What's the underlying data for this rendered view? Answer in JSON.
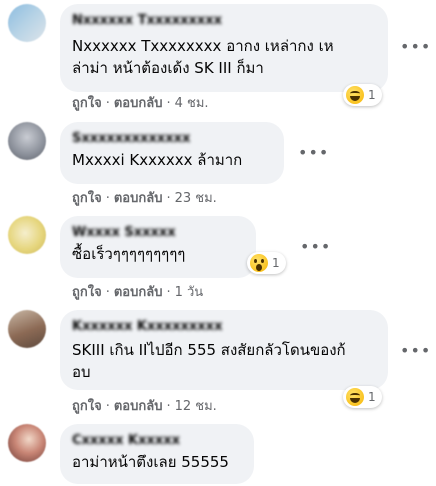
{
  "comments": [
    {
      "name": "Nxxxxxx Txxxxxxxxx",
      "text_lines": [
        "Nxxxxxx Txxxxxxxx อากง เหล่ากง เห",
        "ล่าม่า หน้าต้องเด้ง SK III ก็มา"
      ],
      "like": "ถูกใจ",
      "reply": "ตอบกลับ",
      "time": "4 ชม.",
      "reaction": {
        "icon": "laugh-emoji-icon",
        "count": "1"
      },
      "avatar_colors": [
        "#7fb2d8",
        "#a9c9de",
        "#cfd9e0"
      ]
    },
    {
      "name": "Sxxxxxxxxxxxxx",
      "text_lines": [
        "Mxxxxi Kxxxxxx ล้ามาก"
      ],
      "like": "ถูกใจ",
      "reply": "ตอบกลับ",
      "time": "23 ชม.",
      "avatar_colors": [
        "#6c6f78",
        "#9fa3ad",
        "#c8cad0"
      ]
    },
    {
      "name": "Wxxxx Sxxxxx",
      "text_lines": [
        "ซื้อเร็วๆๆๆๆๆๆๆๆๆ"
      ],
      "like": "ถูกใจ",
      "reply": "ตอบกลับ",
      "time": "1 วัน",
      "reaction": {
        "icon": "wow-emoji-icon",
        "count": "1"
      },
      "avatar_colors": [
        "#e8d57a",
        "#d9c46a",
        "#f2ecc4"
      ]
    },
    {
      "name": "Kxxxxxx Kxxxxxxxxx",
      "text_lines": [
        "SKIII เกิน IIไปอีก 555 สงสัยกลัวโดนของก้",
        "อบ"
      ],
      "like": "ถูกใจ",
      "reply": "ตอบกลับ",
      "time": "12 ชม.",
      "reaction": {
        "icon": "laugh-emoji-icon",
        "count": "1"
      },
      "avatar_colors": [
        "#7a5a49",
        "#a58d72",
        "#c9b9a8"
      ]
    },
    {
      "name": "Cxxxxx Kxxxxx",
      "text_lines": [
        "อาม่าหน้าตึงเลย 55555"
      ],
      "avatar_colors": [
        "#6b3a35",
        "#c97a6a",
        "#e5c7b6"
      ]
    }
  ],
  "colors": {
    "bubble": "#f0f2f5",
    "meta": "#65676b",
    "text": "#050505"
  }
}
